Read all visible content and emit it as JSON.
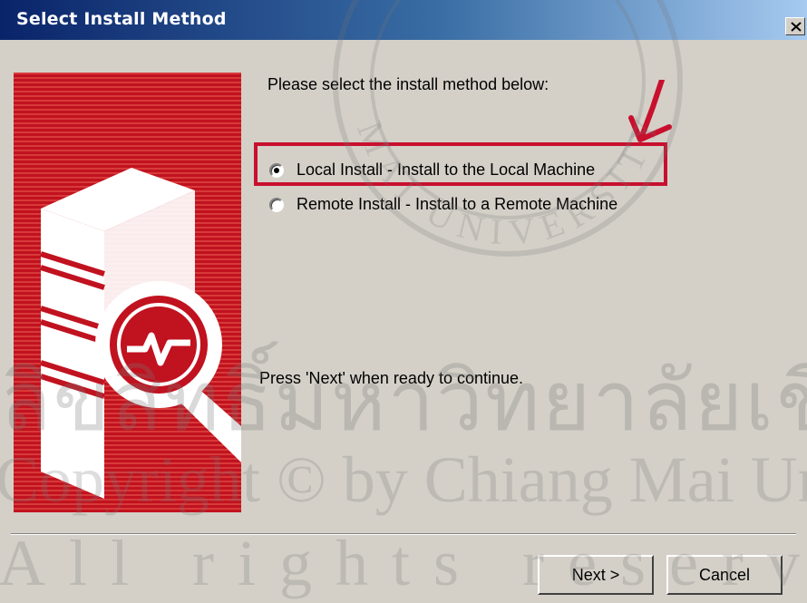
{
  "window": {
    "title": "Select Install Method",
    "close_symbol": "×"
  },
  "content": {
    "prompt": "Please select the install method below:",
    "options": [
      {
        "label": "Local Install - Install to the Local Machine",
        "selected": true
      },
      {
        "label": "Remote Install - Install to a Remote Machine",
        "selected": false
      }
    ],
    "footer_text": "Press 'Next' when ready to continue."
  },
  "buttons": {
    "next": "Next >",
    "cancel": "Cancel"
  },
  "watermark": {
    "thai": "ลิขสิทธิ์มหาวิทยาลัยเชียงใหม่",
    "copyright": "Copyright © by Chiang Mai University",
    "rights": "All rights reserved",
    "seal_text": "MAI UNIVERSITY"
  },
  "colors": {
    "title_gradient_start": "#0a246a",
    "title_gradient_end": "#a6caf0",
    "banner_red": "#c1121f",
    "highlight_red": "#c8102e",
    "dialog_bg": "#d4d0c8"
  },
  "icons": {
    "banner": "server-monitor-icon",
    "close": "close-icon",
    "annotation": "red-arrow-annotation"
  }
}
